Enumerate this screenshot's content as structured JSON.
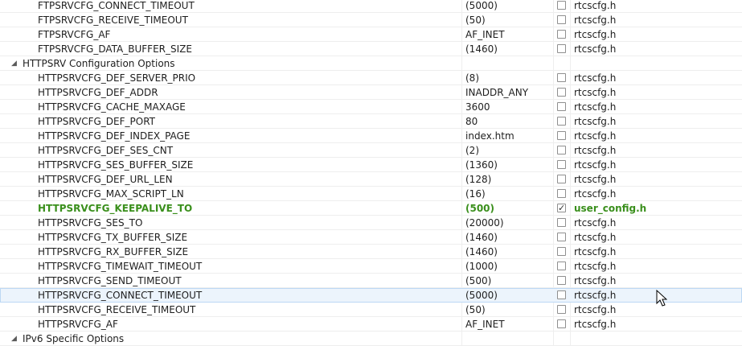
{
  "rows": [
    {
      "type": "item",
      "name": "FTPSRVCFG_CONNECT_TIMEOUT",
      "value": "(5000)",
      "checked": false,
      "file": "rtcscfg.h"
    },
    {
      "type": "item",
      "name": "FTPSRVCFG_RECEIVE_TIMEOUT",
      "value": "(50)",
      "checked": false,
      "file": "rtcscfg.h"
    },
    {
      "type": "item",
      "name": "FTPSRVCFG_AF",
      "value": "AF_INET",
      "checked": false,
      "file": "rtcscfg.h"
    },
    {
      "type": "item",
      "name": "FTPSRVCFG_DATA_BUFFER_SIZE",
      "value": "(1460)",
      "checked": false,
      "file": "rtcscfg.h"
    },
    {
      "type": "group",
      "name": "HTTPSRV Configuration Options",
      "toggle": "◢"
    },
    {
      "type": "item",
      "name": "HTTPSRVCFG_DEF_SERVER_PRIO",
      "value": "(8)",
      "checked": false,
      "file": "rtcscfg.h"
    },
    {
      "type": "item",
      "name": "HTTPSRVCFG_DEF_ADDR",
      "value": "INADDR_ANY",
      "checked": false,
      "file": "rtcscfg.h"
    },
    {
      "type": "item",
      "name": "HTTPSRVCFG_CACHE_MAXAGE",
      "value": "3600",
      "checked": false,
      "file": "rtcscfg.h"
    },
    {
      "type": "item",
      "name": "HTTPSRVCFG_DEF_PORT",
      "value": "80",
      "checked": false,
      "file": "rtcscfg.h"
    },
    {
      "type": "item",
      "name": "HTTPSRVCFG_DEF_INDEX_PAGE",
      "value": "index.htm",
      "checked": false,
      "file": "rtcscfg.h"
    },
    {
      "type": "item",
      "name": "HTTPSRVCFG_DEF_SES_CNT",
      "value": "(2)",
      "checked": false,
      "file": "rtcscfg.h"
    },
    {
      "type": "item",
      "name": "HTTPSRVCFG_SES_BUFFER_SIZE",
      "value": "(1360)",
      "checked": false,
      "file": "rtcscfg.h"
    },
    {
      "type": "item",
      "name": "HTTPSRVCFG_DEF_URL_LEN",
      "value": "(128)",
      "checked": false,
      "file": "rtcscfg.h"
    },
    {
      "type": "item",
      "name": "HTTPSRVCFG_MAX_SCRIPT_LN",
      "value": "(16)",
      "checked": false,
      "file": "rtcscfg.h"
    },
    {
      "type": "item",
      "name": "HTTPSRVCFG_KEEPALIVE_TO",
      "value": "(500)",
      "checked": true,
      "file": "user_config.h",
      "modified": true
    },
    {
      "type": "item",
      "name": "HTTPSRVCFG_SES_TO",
      "value": "(20000)",
      "checked": false,
      "file": "rtcscfg.h"
    },
    {
      "type": "item",
      "name": "HTTPSRVCFG_TX_BUFFER_SIZE",
      "value": "(1460)",
      "checked": false,
      "file": "rtcscfg.h"
    },
    {
      "type": "item",
      "name": "HTTPSRVCFG_RX_BUFFER_SIZE",
      "value": "(1460)",
      "checked": false,
      "file": "rtcscfg.h"
    },
    {
      "type": "item",
      "name": "HTTPSRVCFG_TIMEWAIT_TIMEOUT",
      "value": "(1000)",
      "checked": false,
      "file": "rtcscfg.h"
    },
    {
      "type": "item",
      "name": "HTTPSRVCFG_SEND_TIMEOUT",
      "value": "(500)",
      "checked": false,
      "file": "rtcscfg.h"
    },
    {
      "type": "item",
      "name": "HTTPSRVCFG_CONNECT_TIMEOUT",
      "value": "(5000)",
      "checked": false,
      "file": "rtcscfg.h",
      "selected": true
    },
    {
      "type": "item",
      "name": "HTTPSRVCFG_RECEIVE_TIMEOUT",
      "value": "(50)",
      "checked": false,
      "file": "rtcscfg.h"
    },
    {
      "type": "item",
      "name": "HTTPSRVCFG_AF",
      "value": "AF_INET",
      "checked": false,
      "file": "rtcscfg.h"
    },
    {
      "type": "group",
      "name": "IPv6 Specific Options",
      "toggle": "◢"
    }
  ],
  "colors": {
    "modified": "#3a8f1c",
    "selection": "#ecf4fc"
  },
  "icons": {
    "cursor": "mouse-pointer-icon"
  }
}
